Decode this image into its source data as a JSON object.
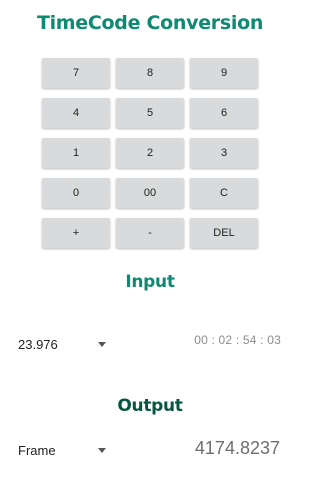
{
  "app": {
    "title": "TimeCode Conversion"
  },
  "keypad": {
    "keys": [
      "7",
      "8",
      "9",
      "4",
      "5",
      "6",
      "1",
      "2",
      "3",
      "0",
      "00",
      "C",
      "+",
      "-",
      "DEL"
    ]
  },
  "input": {
    "title": "Input",
    "framerate": "23.976",
    "timecode": "00 : 02 : 54 : 03"
  },
  "output": {
    "title": "Output",
    "unit": "Frame",
    "value": "4174.8237"
  },
  "colors": {
    "title_accent": "#0f8a72",
    "output_title": "#08563f",
    "key_background": "#d9dadb"
  },
  "icons": {
    "dropdown": "caret-down-icon"
  }
}
